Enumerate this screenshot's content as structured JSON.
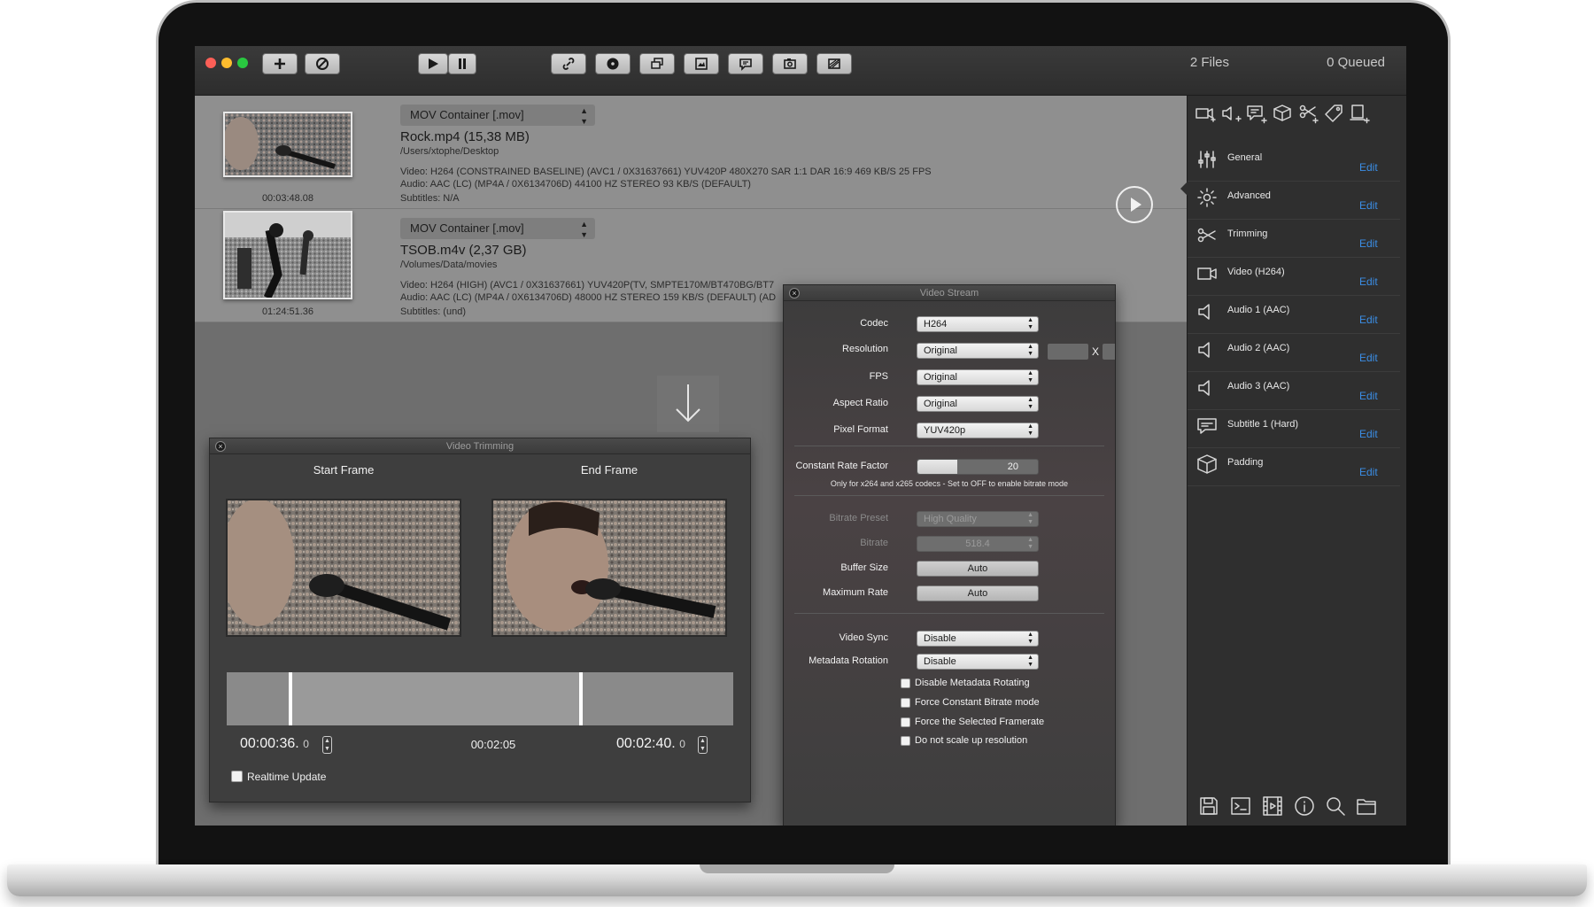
{
  "toolbar": {
    "file_count": "2 Files",
    "queued_count": "0 Queued",
    "icons": [
      "add-icon",
      "clear-icon",
      "play-icon",
      "pause-icon",
      "link-icon",
      "disc-icon",
      "layers-icon",
      "image-icon",
      "subtitle-icon",
      "snapshot-icon",
      "crop-icon"
    ]
  },
  "files": [
    {
      "container": "MOV Container [.mov]",
      "name": "Rock.mp4  (15,38 MB)",
      "path": "/Users/xtophe/Desktop",
      "video": "Video: H264 (CONSTRAINED BASELINE) (AVC1 / 0X31637661)   YUV420P   480X270   SAR 1:1 DAR 16:9   469 KB/S   25 FPS",
      "audio": "Audio: AAC (LC) (MP4A / 0X6134706D)  44100 HZ   STEREO   93 KB/S (DEFAULT)",
      "subtitles": "Subtitles: N/A",
      "duration": "00:03:48.08"
    },
    {
      "container": "MOV Container [.mov]",
      "name": "TSOB.m4v  (2,37 GB)",
      "path": "/Volumes/Data/movies",
      "video": "Video: H264 (HIGH) (AVC1 / 0X31637661)   YUV420P(TV, SMPTE170M/BT470BG/BT7",
      "audio": "Audio: AAC (LC) (MP4A / 0X6134706D)  48000 HZ   STEREO   159 KB/S (DEFAULT) (AD",
      "subtitles": "Subtitles: (und)",
      "duration": "01:24:51.36"
    }
  ],
  "trimming": {
    "title": "Video Trimming",
    "start_label": "Start Frame",
    "end_label": "End Frame",
    "start_time": "00:00:36.",
    "start_frame": "0",
    "end_time": "00:02:40.",
    "end_frame": "0",
    "duration": "00:02:05",
    "realtime_label": "Realtime Update",
    "start_pos": 0.126,
    "end_pos": 0.7
  },
  "video_stream": {
    "title": "Video Stream",
    "codec_label": "Codec",
    "codec": "H264",
    "resolution_label": "Resolution",
    "resolution": "Original",
    "res_x": "X",
    "fps_label": "FPS",
    "fps": "Original",
    "aspect_label": "Aspect Ratio",
    "aspect": "Original",
    "pixfmt_label": "Pixel Format",
    "pixfmt": "YUV420p",
    "crf_label": "Constant Rate Factor",
    "crf": "20",
    "crf_fill": 0.33,
    "crf_note": "Only for x264 and x265 codecs   -   Set to OFF to enable bitrate mode",
    "preset_label": "Bitrate Preset",
    "preset": "High Quality",
    "bitrate_label": "Bitrate",
    "bitrate": "518.4",
    "buffer_label": "Buffer Size",
    "buffer": "Auto",
    "maxrate_label": "Maximum Rate",
    "maxrate": "Auto",
    "sync_label": "Video Sync",
    "sync": "Disable",
    "rotation_label": "Metadata Rotation",
    "rotation": "Disable",
    "checks": [
      "Disable Metadata Rotating",
      "Force Constant Bitrate mode",
      "Force the Selected Framerate",
      "Do not scale up resolution"
    ]
  },
  "sidebar": {
    "edit_label": "Edit",
    "items": [
      {
        "label": "General",
        "icon": "sliders-icon"
      },
      {
        "label": "Advanced",
        "icon": "gear-icon"
      },
      {
        "label": "Trimming",
        "icon": "scissors-icon"
      },
      {
        "label": "Video (H264)",
        "icon": "video-camera-icon"
      },
      {
        "label": "Audio 1 (AAC)",
        "icon": "speaker-icon"
      },
      {
        "label": "Audio 2 (AAC)",
        "icon": "speaker-icon"
      },
      {
        "label": "Audio 3 (AAC)",
        "icon": "speaker-icon"
      },
      {
        "label": "Subtitle 1 (Hard)",
        "icon": "subtitle-icon"
      },
      {
        "label": "Padding",
        "icon": "box-icon"
      }
    ]
  },
  "colors": {
    "accent": "#3b8ee6",
    "panel": "#3e3e3e",
    "row": "#8f8f8f"
  }
}
